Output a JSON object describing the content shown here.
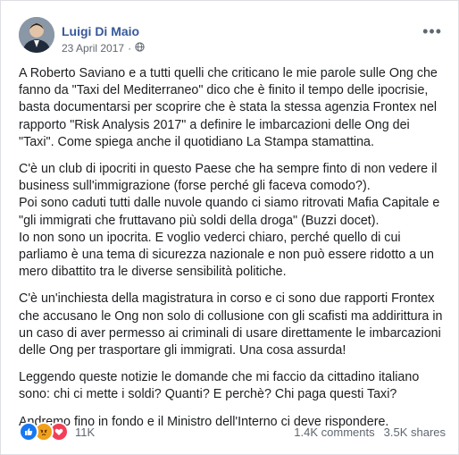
{
  "post": {
    "author": "Luigi Di Maio",
    "date": "23 April 2017",
    "privacy_icon": "globe-icon",
    "more_icon": "more-options-icon",
    "paragraphs": [
      "A Roberto Saviano e a tutti quelli che criticano le mie parole sulle Ong che fanno da \"Taxi del Mediterraneo\" dico che è finito il tempo delle ipocrisie, basta documentarsi per scoprire che è stata la stessa agenzia Frontex nel rapporto \"Risk Analysis 2017\" a definire le imbarcazioni delle Ong dei \"Taxi\". Come spiega anche il quotidiano La Stampa stamattina.",
      "C'è un club di ipocriti in questo Paese che ha sempre finto di non vedere il business sull'immigrazione (forse perché gli faceva comodo?).\nPoi sono caduti tutti dalle nuvole quando ci siamo ritrovati Mafia Capitale e \"gli immigrati che fruttavano più soldi della droga\" (Buzzi docet).\nIo non sono un ipocrita. E voglio vederci chiaro, perché quello di cui parliamo è una tema di sicurezza nazionale e non può essere ridotto a un mero dibattito tra le diverse sensibilità politiche.",
      "C'è un'inchiesta della magistratura in corso e ci sono due rapporti Frontex che accusano le Ong non solo di collusione con gli scafisti ma addirittura in un caso di aver permesso ai criminali di usare direttamente le imbarcazioni delle Ong per trasportare gli immigrati. Una cosa assurda!",
      "Leggendo queste notizie le domande che mi faccio da cittadino italiano sono: chi ci mette i soldi? Quanti? E perchè? Chi paga questi Taxi?",
      "Andremo fino in fondo e il Ministro dell'Interno ci deve rispondere."
    ]
  },
  "footer": {
    "reactions_count": "11K",
    "comments": "1.4K comments",
    "shares": "3.5K shares"
  },
  "colors": {
    "author": "#385898",
    "like": "#1877f2",
    "angry": "#f0a01a",
    "love": "#f33e58"
  }
}
